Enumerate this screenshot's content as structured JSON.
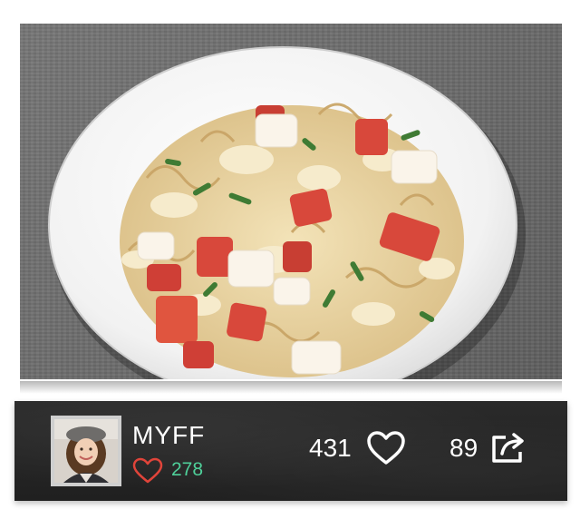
{
  "post": {
    "author": "MYFF",
    "author_likes": "278",
    "likes": "431",
    "shares": "89"
  },
  "icons": {
    "author_like": "heart-outline-icon",
    "like": "heart-icon",
    "share": "share-icon"
  },
  "colors": {
    "accent_green": "#4fd09a",
    "author_heart": "#e0443a",
    "bar_background": "#242424"
  }
}
